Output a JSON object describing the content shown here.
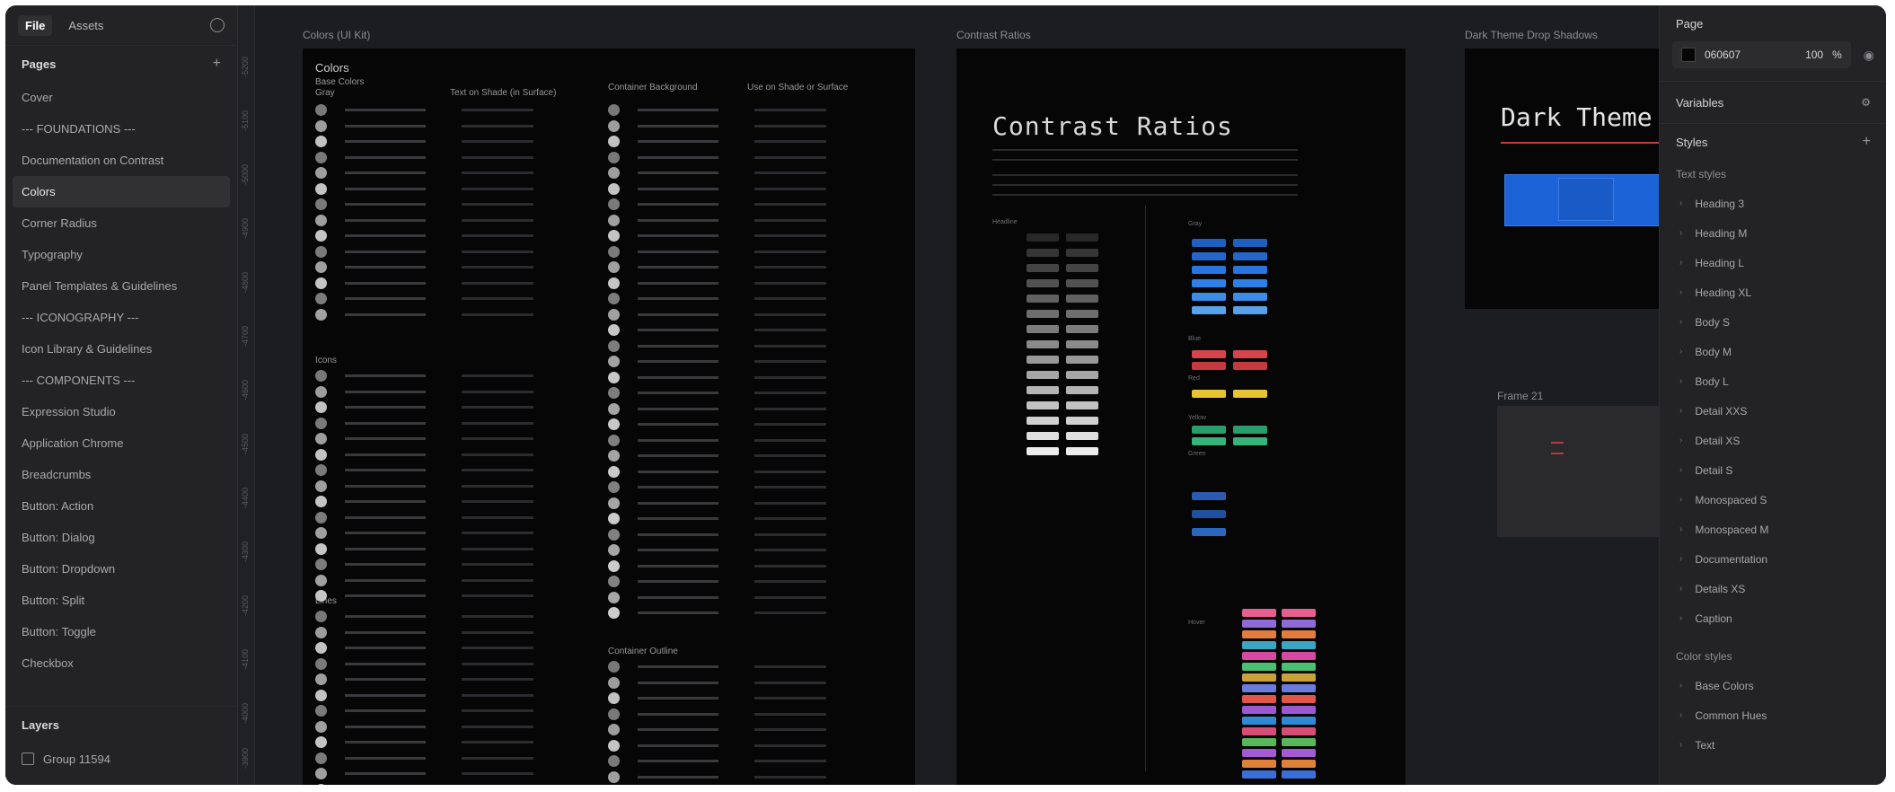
{
  "left_panel": {
    "tabs": [
      "File",
      "Assets"
    ],
    "pages_heading": "Pages",
    "pages": [
      "Cover",
      "--- FOUNDATIONS ---",
      "Documentation on Contrast",
      "Colors",
      "Corner Radius",
      "Typography",
      "Panel Templates & Guidelines",
      "--- ICONOGRAPHY ---",
      "Icon Library & Guidelines",
      "--- COMPONENTS ---",
      "Expression Studio",
      "Application Chrome",
      "Breadcrumbs",
      "Button: Action",
      "Button: Dialog",
      "Button: Dropdown",
      "Button: Split",
      "Button: Toggle",
      "Checkbox"
    ],
    "selected_page": "Colors",
    "layers_heading": "Layers",
    "layer_item": "Group 11594"
  },
  "canvas": {
    "ruler_ticks": [
      "-5200",
      "-5100",
      "-5000",
      "-4900",
      "-4800",
      "-4700",
      "-4600",
      "-4500",
      "-4400",
      "-4300",
      "-4200",
      "-4100",
      "-4000",
      "-3900"
    ],
    "frame_labels": {
      "colors": "Colors (UI Kit)",
      "contrast": "Contrast Ratios",
      "dark": "Dark Theme Drop Shadows",
      "frame21": "Frame 21"
    },
    "colors_frame": {
      "title": "Colors",
      "section_base": "Base Colors",
      "col_headers": [
        "Gray",
        "Text on Shade (in Surface)",
        "Container Background",
        "Use on Shade or Surface"
      ],
      "section_2": "Icons",
      "section_3": "Lines",
      "section_4": "Container Outline"
    },
    "contrast_frame": {
      "title": "Contrast Ratios",
      "labels": [
        "Gray",
        "Blue",
        "Red",
        "Yellow",
        "Green",
        "Hover",
        "Headline"
      ]
    },
    "dark_frame": {
      "title": "Dark Theme"
    },
    "colors": {
      "canvas_bg": "#1c1d20",
      "frame_bg": "#060607",
      "accent_blue": "#1c63d8"
    }
  },
  "right_panel": {
    "page_heading": "Page",
    "page_color": "060607",
    "page_opacity": "100",
    "page_opacity_unit": "%",
    "variables_heading": "Variables",
    "styles_heading": "Styles",
    "text_styles_heading": "Text styles",
    "text_styles": [
      "Heading 3",
      "Heading M",
      "Heading L",
      "Heading XL",
      "Body S",
      "Body M",
      "Body L",
      "Detail XXS",
      "Detail XS",
      "Detail S",
      "Monospaced S",
      "Monospaced M",
      "Documentation",
      "Details XS",
      "Caption"
    ],
    "color_styles_heading": "Color styles",
    "color_styles": [
      "Base Colors",
      "Common Hues",
      "Text"
    ]
  }
}
